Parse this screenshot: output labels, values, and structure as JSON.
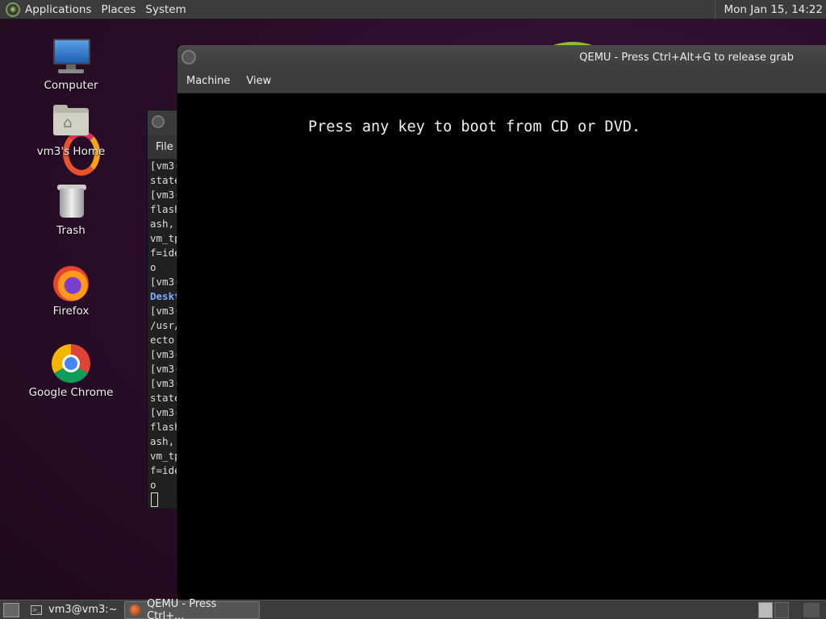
{
  "top_panel": {
    "menus": [
      "Applications",
      "Places",
      "System"
    ],
    "clock": "Mon Jan 15, 14:22"
  },
  "desktop_icons": [
    {
      "label": "Computer",
      "icon": "computer-icon"
    },
    {
      "label": "vm3's Home",
      "icon": "home-folder-icon"
    },
    {
      "label": "Trash",
      "icon": "trash-icon"
    },
    {
      "label": "Firefox",
      "icon": "firefox-icon"
    },
    {
      "label": "Google Chrome",
      "icon": "chrome-icon"
    }
  ],
  "terminal": {
    "menu_file": "File",
    "lines": [
      "[vm3(",
      "state",
      "[vm3(",
      "flash",
      "ash,",
      "vm_tp",
      "f=ide",
      "o",
      "[vm3(",
      "Deskt",
      "[vm3(",
      "/usr/",
      "ecto",
      "[vm3(",
      "[vm3(",
      "[vm3(",
      "state",
      "[vm3(",
      "flash",
      "ash,",
      "vm_tp",
      "f=ide",
      "o"
    ]
  },
  "qemu": {
    "title": "QEMU - Press Ctrl+Alt+G to release grab",
    "menus": [
      "Machine",
      "View"
    ],
    "boot_message": "Press any key to boot from CD or DVD."
  },
  "bottom_panel": {
    "tasks": [
      {
        "label": "vm3@vm3:~",
        "active": false
      },
      {
        "label": "QEMU - Press Ctrl+...",
        "active": true
      }
    ]
  }
}
